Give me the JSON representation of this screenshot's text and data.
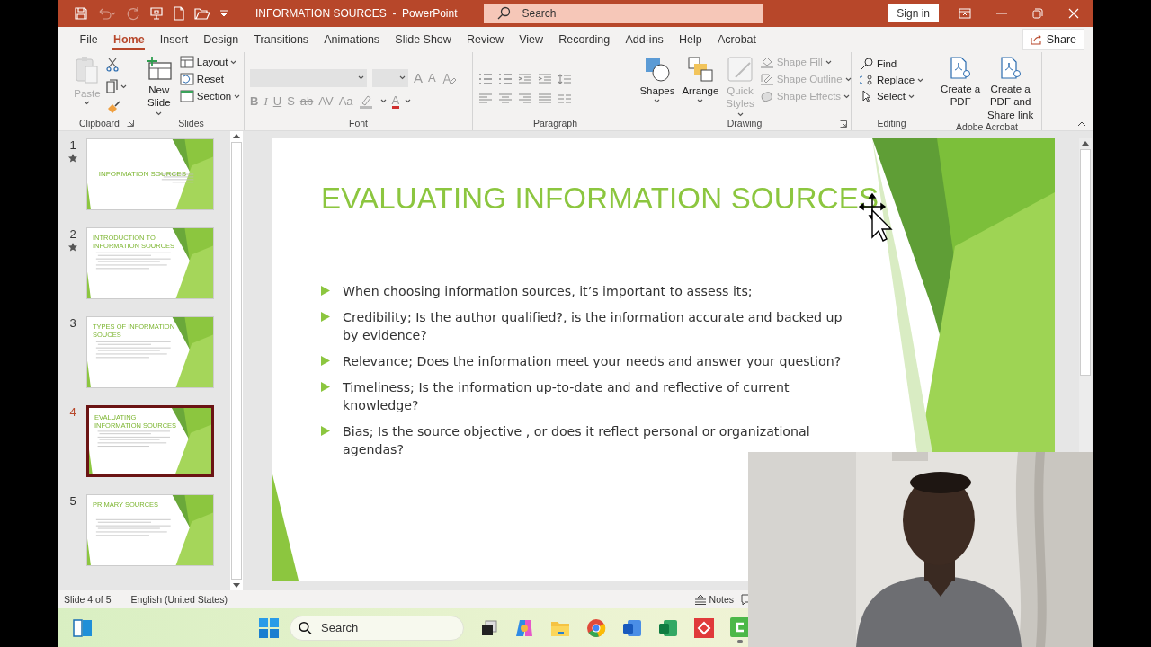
{
  "title_bar": {
    "document_title": "INFORMATION SOURCES  -  PowerPoint",
    "search": {
      "placeholder": "Search"
    },
    "sign_in": "Sign in"
  },
  "tabs": [
    {
      "label": "File",
      "selected": false
    },
    {
      "label": "Home",
      "selected": true
    },
    {
      "label": "Insert",
      "selected": false
    },
    {
      "label": "Design",
      "selected": false
    },
    {
      "label": "Transitions",
      "selected": false
    },
    {
      "label": "Animations",
      "selected": false
    },
    {
      "label": "Slide Show",
      "selected": false
    },
    {
      "label": "Review",
      "selected": false
    },
    {
      "label": "View",
      "selected": false
    },
    {
      "label": "Recording",
      "selected": false
    },
    {
      "label": "Add-ins",
      "selected": false
    },
    {
      "label": "Help",
      "selected": false
    },
    {
      "label": "Acrobat",
      "selected": false
    }
  ],
  "share": "Share",
  "ribbon": {
    "clipboard": {
      "label": "Clipboard",
      "paste": {
        "label": "Paste",
        "disabled": true
      }
    },
    "slides": {
      "label": "Slides",
      "new_slide": "New Slide",
      "buttons": [
        "Layout",
        "Reset",
        "Section"
      ]
    },
    "font": {
      "label": "Font",
      "disabled": true,
      "grow": "A",
      "shrink": "A",
      "format_buttons": [
        "B",
        "I",
        "U",
        "S",
        "ab",
        "AV",
        "Aa"
      ],
      "color_button": "A"
    },
    "paragraph": {
      "label": "Paragraph"
    },
    "drawing": {
      "label": "Drawing",
      "large": [
        {
          "label": "Shapes",
          "kind": "shapes",
          "disabled": false
        },
        {
          "label": "Arrange",
          "kind": "arrange",
          "disabled": false
        },
        {
          "label": "Quick Styles",
          "kind": "styles",
          "disabled": true
        }
      ],
      "small": [
        {
          "label": "Shape Fill",
          "kind": "fill",
          "disabled": true
        },
        {
          "label": "Shape Outline",
          "kind": "outline",
          "disabled": true
        },
        {
          "label": "Shape Effects",
          "kind": "effects",
          "disabled": true
        }
      ]
    },
    "editing": {
      "label": "Editing",
      "items": [
        {
          "label": "Find",
          "kind": "find"
        },
        {
          "label": "Replace",
          "kind": "replace"
        },
        {
          "label": "Select",
          "kind": "select"
        }
      ]
    },
    "acrobat": {
      "label": "Adobe Acrobat",
      "items": [
        "Create a PDF",
        "Create a PDF and Share link"
      ]
    }
  },
  "thumbnails": [
    {
      "number": "1",
      "title": "INFORMATION SOURCES",
      "kind": "title",
      "has_animation": true,
      "selected": false
    },
    {
      "number": "2",
      "title": "INTRODUCTION TO INFORMATION SOURCES",
      "kind": "content",
      "has_animation": true,
      "selected": false
    },
    {
      "number": "3",
      "title": "TYPES OF INFORMATION SOUCES",
      "kind": "content",
      "has_animation": false,
      "selected": false
    },
    {
      "number": "4",
      "title": "EVALUATING INFORMATION SOURCES",
      "kind": "content",
      "has_animation": false,
      "selected": true
    },
    {
      "number": "5",
      "title": "PRIMARY SOURCES",
      "kind": "content",
      "has_animation": false,
      "selected": false
    }
  ],
  "slide": {
    "title": "EVALUATING INFORMATION SOURCES",
    "bullets": [
      "When choosing information sources, it’s important to assess its;",
      "Credibility; Is the author qualified?, is the information accurate and backed up by evidence?",
      "Relevance; Does the information meet your needs and answer your question?",
      "Timeliness; Is the information up-to-date and and reflective of current knowledge?",
      "Bias; Is the source objective , or does it reflect personal or organizational agendas?"
    ]
  },
  "status_bar": {
    "slide_position": "Slide 4 of 5",
    "language": "English (United States)",
    "notes": "Notes"
  },
  "taskbar": {
    "search": {
      "placeholder": "Search"
    }
  }
}
